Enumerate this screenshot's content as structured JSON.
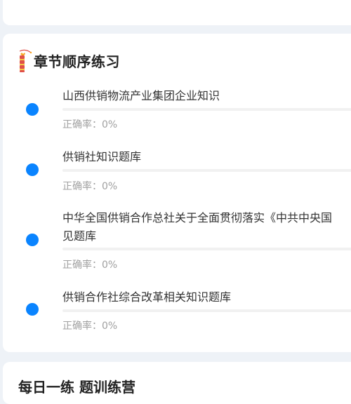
{
  "section": {
    "title": "章节顺序练习"
  },
  "chapters": [
    {
      "title": "山西供销物流产业集团企业知识",
      "accuracy": "正确率：0%",
      "progress": 0
    },
    {
      "title": "供销社知识题库",
      "accuracy": "正确率：0%",
      "progress": 0
    },
    {
      "title_line1": "中华全国供销合作总社关于全面贯彻落实《中共中央国",
      "title_line2": "见题库",
      "accuracy": "正确率：0%",
      "progress": 0
    },
    {
      "title": "供销合作社综合改革相关知识题库",
      "accuracy": "正确率：0%",
      "progress": 0
    }
  ],
  "next_section": {
    "title": "每日一练   题训练营"
  },
  "colors": {
    "accent": "#0a84ff",
    "muted_text": "#a0a0a0",
    "background": "#eef2f7"
  }
}
